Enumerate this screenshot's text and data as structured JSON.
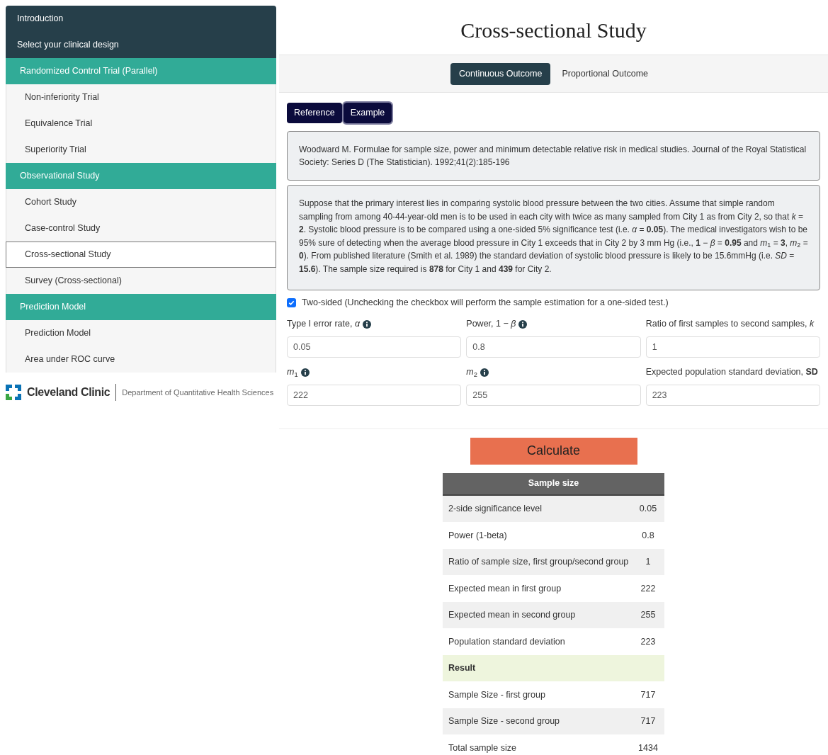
{
  "sidebar": {
    "items": [
      {
        "kind": "header",
        "label": "Introduction",
        "selected": false
      },
      {
        "kind": "header",
        "label": "Select your clinical design",
        "selected": false
      },
      {
        "kind": "section",
        "label": "Randomized Control Trial (Parallel)",
        "selected": false
      },
      {
        "kind": "link",
        "label": "Non-inferiority Trial",
        "selected": false
      },
      {
        "kind": "link",
        "label": "Equivalence Trial",
        "selected": false
      },
      {
        "kind": "link",
        "label": "Superiority Trial",
        "selected": false
      },
      {
        "kind": "section",
        "label": "Observational Study",
        "selected": false
      },
      {
        "kind": "link",
        "label": "Cohort Study",
        "selected": false
      },
      {
        "kind": "link",
        "label": "Case-control Study",
        "selected": false
      },
      {
        "kind": "link",
        "label": "Cross-sectional Study",
        "selected": true
      },
      {
        "kind": "link",
        "label": "Survey (Cross-sectional)",
        "selected": false
      },
      {
        "kind": "section",
        "label": "Prediction Model",
        "selected": false
      },
      {
        "kind": "link",
        "label": "Prediction Model",
        "selected": false
      },
      {
        "kind": "link",
        "label": "Area under ROC curve",
        "selected": false
      }
    ],
    "footer": {
      "brand": "Cleveland Clinic",
      "department": "Department of Quantitative Health Sciences"
    }
  },
  "title": "Cross-sectional Study",
  "tabs": [
    {
      "label": "Continuous Outcome",
      "selected": true
    },
    {
      "label": "Proportional Outcome",
      "selected": false
    }
  ],
  "buttons": [
    {
      "label": "Reference",
      "selected": false
    },
    {
      "label": "Example",
      "selected": true
    }
  ],
  "reference": "Woodward M. Formulae for sample size, power and minimum detectable relative risk in medical studies. Journal of the Royal Statistical Society: Series D (The Statistician). 1992;41(2):185-196",
  "example": "Suppose that the primary interest lies in comparing systolic blood pressure between the two cities. Assume that simple random sampling from among 40-44-year-old men is to be used in each city with twice as many sampled from City 1 as from City 2, so that *k* = **2**. Systolic blood pressure is to be compared using a one-sided 5% significance test (i.e. *α* = **0.05**). The medical investigators wish to be 95% sure of detecting when the average blood pressure in City 1 exceeds that in City 2 by 3 mm Hg (i.e., **1** − *β* = **0.95** and *m*$_{1}$ = **3**, *m*$_{2}$ = **0**). From published literature (Smith et al. 1989) the standard deviation of systolic blood pressure is likely to be 15.6mmHg (i.e. *SD* = **15.6**). The sample size required is **878** for City 1 and **439** for City 2.",
  "two_sided": {
    "label": "Two-sided (Unchecking the checkbox will perform the sample estimation for a one-sided test.)",
    "checked": true
  },
  "fields": [
    {
      "label": "Type I error rate, *α*",
      "info": true,
      "value": "0.05"
    },
    {
      "label": "Power, 1 − *β*",
      "info": true,
      "value": "0.8"
    },
    {
      "label": "Ratio of first samples to second samples, *k*",
      "info": false,
      "value": "1"
    },
    {
      "label": "*m*$_{1}$",
      "info": true,
      "value": "222"
    },
    {
      "label": "*m*$_{2}$",
      "info": true,
      "value": "255"
    },
    {
      "label": "Expected population standard deviation, **SD**",
      "info": false,
      "value": "223"
    }
  ],
  "calculate": "Calculate",
  "table": {
    "title": "Sample size",
    "rows": [
      {
        "kind": "row",
        "label": "2-side significance level",
        "value": "0.05"
      },
      {
        "kind": "row",
        "label": "Power (1-beta)",
        "value": "0.8"
      },
      {
        "kind": "row",
        "label": "Ratio of sample size, first group/second group",
        "value": "1"
      },
      {
        "kind": "row",
        "label": "Expected mean in first group",
        "value": "222"
      },
      {
        "kind": "row",
        "label": "Expected mean in second group",
        "value": "255"
      },
      {
        "kind": "row",
        "label": "Population standard deviation",
        "value": "223"
      },
      {
        "kind": "heading",
        "label": "Result"
      },
      {
        "kind": "row",
        "label": "Sample Size - first group",
        "value": "717"
      },
      {
        "kind": "row",
        "label": "Sample Size - second group",
        "value": "717"
      },
      {
        "kind": "row",
        "label": "Total sample size",
        "value": "1434"
      }
    ]
  }
}
